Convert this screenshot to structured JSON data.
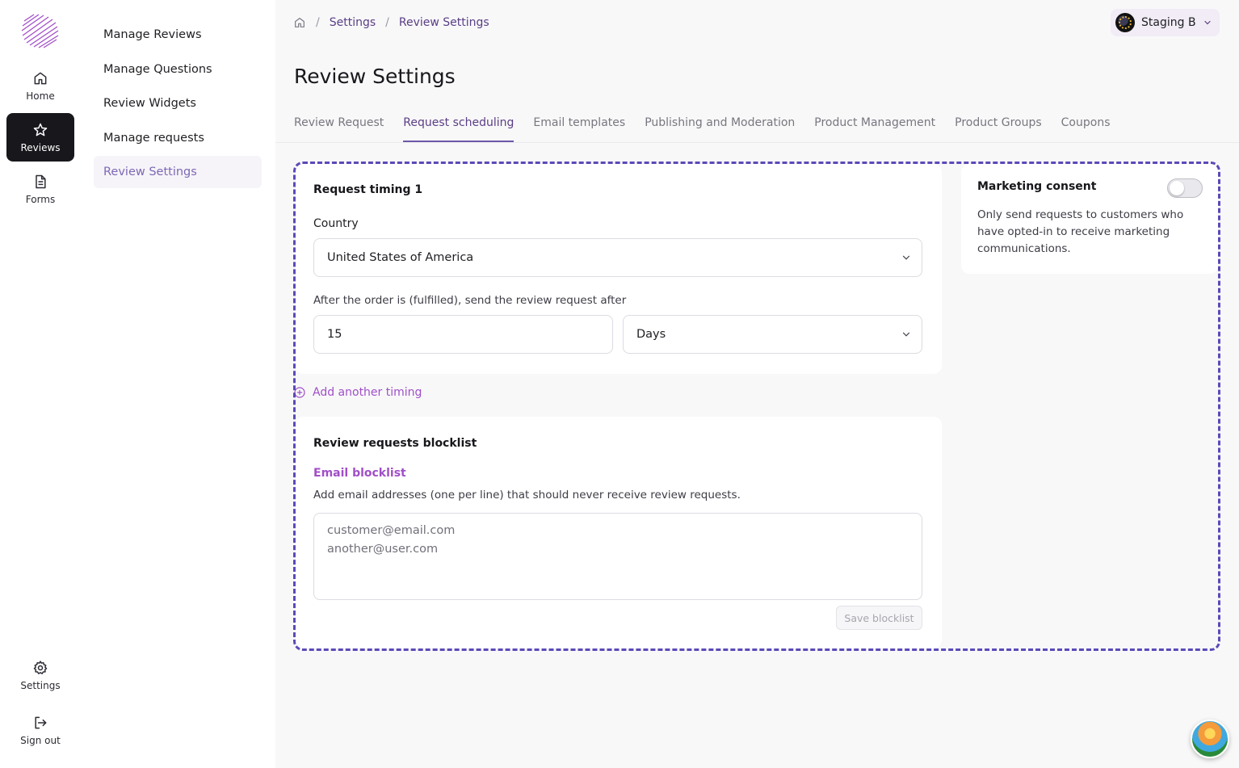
{
  "rail": {
    "home": "Home",
    "reviews": "Reviews",
    "forms": "Forms",
    "settings": "Settings",
    "signout": "Sign out"
  },
  "subnav": {
    "items": [
      "Manage Reviews",
      "Manage Questions",
      "Review Widgets",
      "Manage requests",
      "Review Settings"
    ],
    "active_index": 4
  },
  "breadcrumb": {
    "home_icon": "home-icon",
    "items": [
      "Settings",
      "Review Settings"
    ],
    "separator": "/"
  },
  "workspace": {
    "name": "Staging B"
  },
  "page": {
    "title": "Review Settings"
  },
  "tabs": {
    "items": [
      "Review Request",
      "Request scheduling",
      "Email templates",
      "Publishing and Moderation",
      "Product Management",
      "Product Groups",
      "Coupons"
    ],
    "active_index": 1
  },
  "timing": {
    "heading": "Request timing 1",
    "country_label": "Country",
    "country_value": "United States of America",
    "after_label": "After the order is (fulfilled), send the review request after",
    "amount_value": "15",
    "unit_value": "Days"
  },
  "add_timing": {
    "label": "Add another timing"
  },
  "blocklist": {
    "heading": "Review requests blocklist",
    "email_label": "Email blocklist",
    "description": "Add email addresses (one per line) that should never receive review requests.",
    "placeholder": "customer@email.com\nanother@user.com",
    "save_label": "Save blocklist"
  },
  "consent": {
    "title": "Marketing consent",
    "enabled": false,
    "description": "Only send requests to customers who have opted-in to receive marketing communications."
  },
  "colors": {
    "accent": "#6f58a8",
    "link_purple": "#a04fc8",
    "dashed_border": "#5a4ab8",
    "active_rail": "#17171c"
  }
}
